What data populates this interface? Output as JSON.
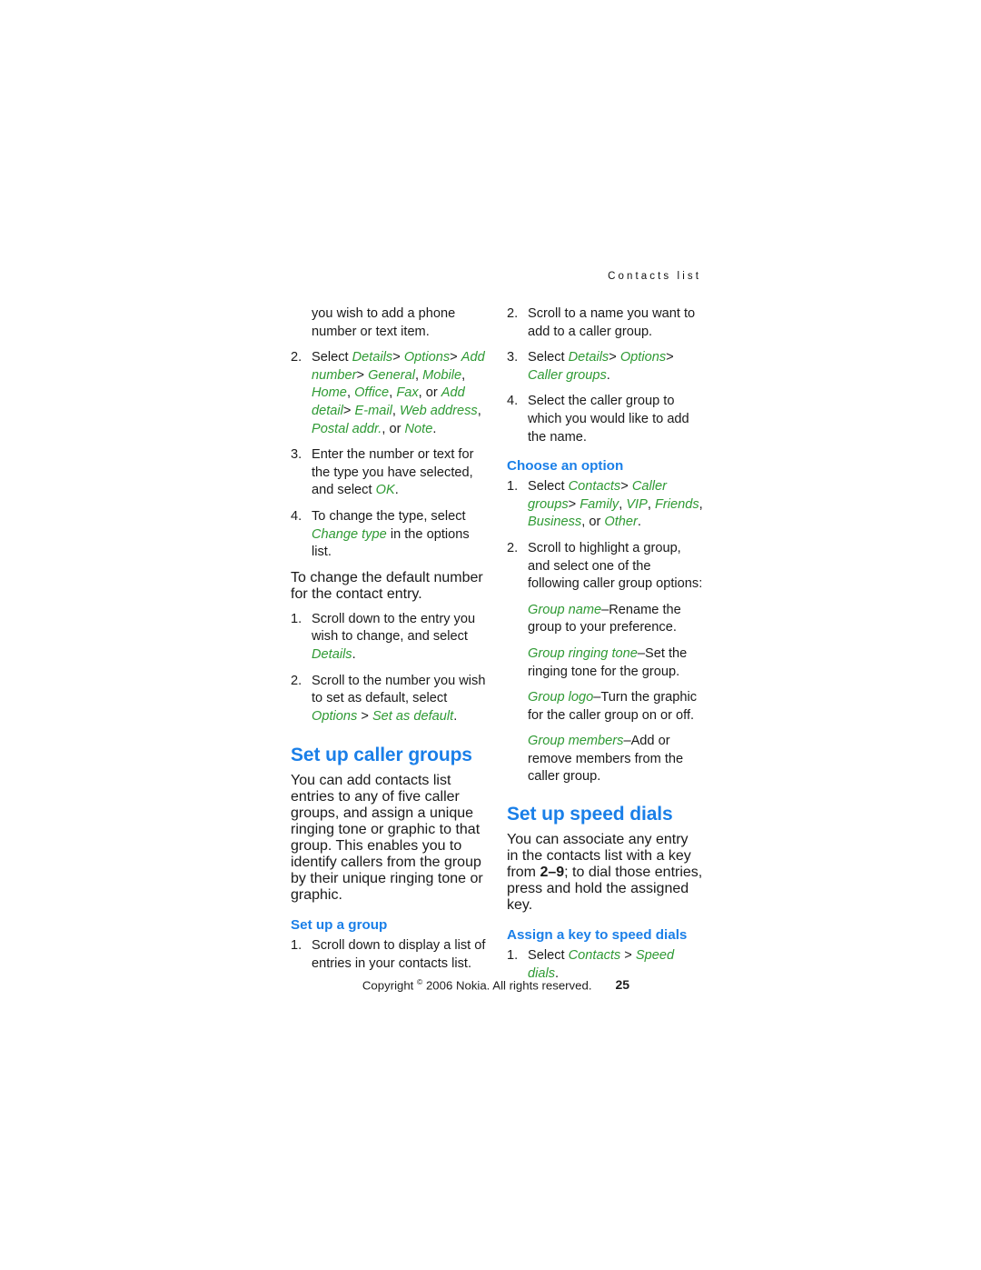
{
  "document": {
    "running_header": "Contacts list",
    "page_number": "25",
    "copyright": "Copyright",
    "copyright_symbol": "©",
    "copyright_rest": "2006 Nokia. All rights reserved.",
    "colors": {
      "heading_blue": "#1a7fe8",
      "ui_label_green": "#2f9a34",
      "body_text": "#1c1c1c",
      "page_background": "#ffffff"
    }
  },
  "left_column": {
    "continuation_paragraph": "you wish to add a phone number or text item.",
    "item_2": {
      "number": "2.",
      "lead": "Select",
      "ui_1": "Details",
      "sep_1": ">",
      "ui_2": "Options",
      "sep_2": ">",
      "ui_3": "Add number",
      "sep_3": ">",
      "ui_4": "General",
      "c1": ",",
      "ui_5": "Mobile",
      "c2": ",",
      "ui_6": "Home",
      "c3": ",",
      "ui_7": "Office",
      "c4": ",",
      "ui_8": "Fax",
      "c5": ", or",
      "ui_9": "Add detail",
      "sep_4": ">",
      "ui_10": "E-mail",
      "c6": ",",
      "ui_11": "Web address",
      "c7": ",",
      "ui_12": "Postal addr.",
      "c8": ", or",
      "ui_13": "Note",
      "c9": "."
    },
    "item_3": {
      "number": "3.",
      "lead": "Enter the number or text for the type you have selected, and select",
      "ui_1": "OK",
      "tail": "."
    },
    "item_4": {
      "number": "4.",
      "lead": "To change the type, select",
      "ui_1": "Change type",
      "tail": "in the options list."
    },
    "default_number_paragraph": "To change the default number for the contact entry.",
    "default_item_1": {
      "number": "1.",
      "lead": "Scroll down to the entry you wish to change, and select",
      "ui_1": "Details",
      "tail": "."
    },
    "default_item_2": {
      "number": "2.",
      "lead": "Scroll to the number you wish to set as default, select",
      "ui_1": "Options",
      "sep_1": ">",
      "ui_2": "Set as default",
      "tail": "."
    },
    "caller_groups_heading": "Set up caller groups",
    "caller_groups_body": "You can add contacts list entries to any of five caller groups, and assign a unique ringing tone or graphic to that group. This enables you to identify callers from the group by their unique ringing tone or graphic.",
    "set_up_a_group_subheading": "Set up a group",
    "set_up_group_item_1": {
      "number": "1.",
      "lead": "Scroll down to display a list of entries in your contacts list."
    }
  },
  "right_column": {
    "item_2": {
      "number": "2.",
      "lead": "Scroll to a name you want to add to a caller group."
    },
    "item_3": {
      "number": "3.",
      "lead": "Select",
      "ui_1": "Details",
      "sep_1": ">",
      "ui_2": "Options",
      "sep_2": ">",
      "ui_3": "Caller groups",
      "tail": "."
    },
    "item_4": {
      "number": "4.",
      "lead": "Select the caller group to which you would like to add the name."
    },
    "choose_option_subheading": "Choose an option",
    "choose_item_1": {
      "number": "1.",
      "lead": "Select",
      "ui_1": "Contacts",
      "sep_1": ">",
      "ui_2": "Caller groups",
      "sep_2": ">",
      "ui_3": "Family",
      "c1": ",",
      "ui_4": "VIP",
      "c2": ",",
      "ui_5": "Friends",
      "c3": ",",
      "ui_6": "Business",
      "c4": ", or",
      "ui_7": "Other",
      "c5": "."
    },
    "choose_item_2": {
      "number": "2.",
      "lead": "Scroll to highlight a group, and select one of the following caller group options:"
    },
    "options": [
      {
        "label": "Group name",
        "dash": "–",
        "description": "Rename the group to your preference."
      },
      {
        "label": "Group ringing tone",
        "dash": "–",
        "description": "Set the ringing tone for the group."
      },
      {
        "label": "Group logo",
        "dash": "–",
        "description": "Turn the graphic for the caller group on or off."
      },
      {
        "label": "Group members",
        "dash": "–",
        "description": "Add or remove members from the caller group."
      }
    ],
    "speed_dials_heading": "Set up speed dials",
    "speed_dials_body_1": "You can associate any entry in the contacts list with a key from",
    "speed_dials_key_range": "2–9",
    "speed_dials_body_2": "; to dial those entries, press and hold the assigned key.",
    "assign_key_subheading": "Assign a key to speed dials",
    "assign_item_1": {
      "number": "1.",
      "lead": "Select",
      "ui_1": "Contacts",
      "sep_1": ">",
      "ui_2": "Speed dials",
      "tail": "."
    }
  }
}
